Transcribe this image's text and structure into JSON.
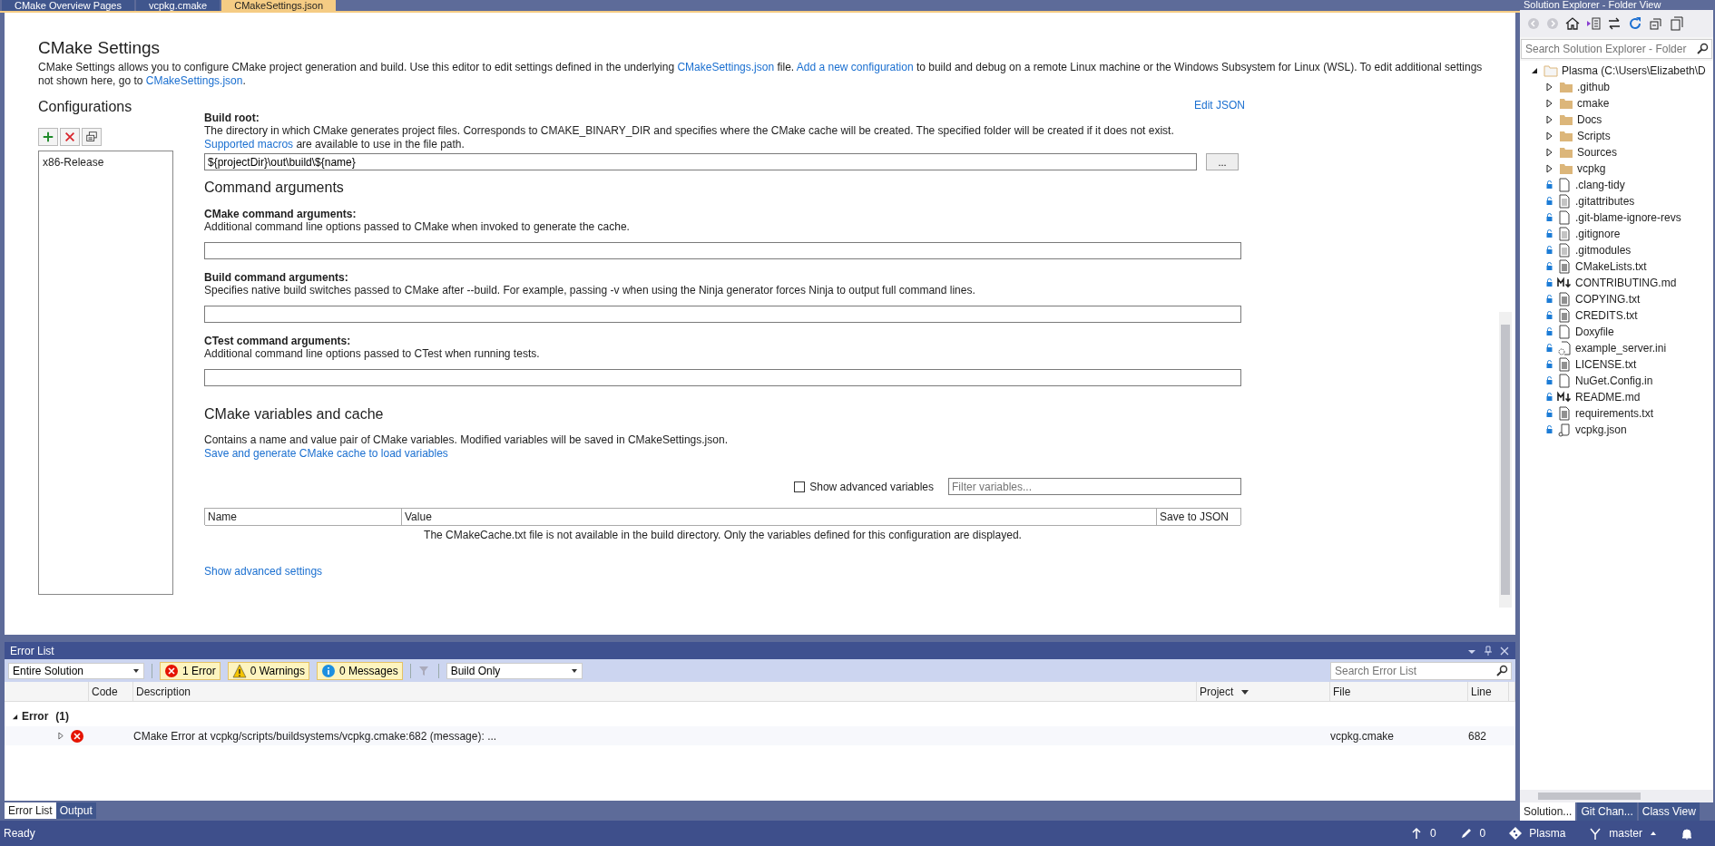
{
  "document_tabs": [
    {
      "label": "CMake Overview Pages",
      "selected": false
    },
    {
      "label": "vcpkg.cmake",
      "selected": false
    },
    {
      "label": "CMakeSettings.json",
      "selected": true
    }
  ],
  "settings": {
    "title": "CMake Settings",
    "intro": [
      {
        "kind": "text",
        "text": "CMake Settings allows you to configure CMake project generation and build. Use this editor to edit settings defined in the underlying "
      },
      {
        "kind": "link",
        "text": "CMakeSettings.json"
      },
      {
        "kind": "text",
        "text": " file. "
      },
      {
        "kind": "link",
        "text": "Add a new configuration"
      },
      {
        "kind": "text",
        "text": " to build and debug on a remote Linux machine or the Windows Subsystem for Linux (WSL). To edit additional settings not shown here, go to "
      },
      {
        "kind": "link",
        "text": "CMakeSettings.json"
      },
      {
        "kind": "text",
        "text": "."
      }
    ],
    "edit_json": "Edit JSON"
  },
  "configurations": {
    "heading": "Configurations",
    "items": [
      {
        "label": "x86-Release"
      }
    ]
  },
  "build_root": {
    "label": "Build root:",
    "description": [
      {
        "kind": "text",
        "text": "The directory in which CMake generates project files. Corresponds to CMAKE_BINARY_DIR and specifies where the CMake cache will be created. The specified folder will be created if it does not exist. "
      },
      {
        "kind": "link",
        "text": "Supported macros"
      },
      {
        "kind": "text",
        "text": " are available to use in the file path."
      }
    ],
    "value": "${projectDir}\\out\\build\\${name}",
    "browse": "..."
  },
  "command_arguments": {
    "heading": "Command arguments",
    "fields": [
      {
        "label": "CMake command arguments:",
        "description": "Additional command line options passed to CMake when invoked to generate the cache."
      },
      {
        "label": "Build command arguments:",
        "description": "Specifies native build switches passed to CMake after --build. For example, passing -v when using the Ninja generator forces Ninja to output full command lines."
      },
      {
        "label": "CTest command arguments:",
        "description": "Additional command line options passed to CTest when running tests."
      }
    ]
  },
  "variables": {
    "heading": "CMake variables and cache",
    "description": "Contains a name and value pair of CMake variables. Modified variables will be saved in CMakeSettings.json.",
    "link": "Save and generate CMake cache to load variables",
    "show_advanced": {
      "label": "Show advanced variables",
      "checked": false
    },
    "filter_placeholder": "Filter variables...",
    "columns": [
      "Name",
      "Value",
      "Save to JSON"
    ],
    "empty_message": "The CMakeCache.txt file is not available in the build directory. Only the variables defined for this configuration are displayed."
  },
  "show_advanced_settings": "Show advanced settings",
  "error_list": {
    "title": "Error List",
    "scope": "Entire Solution",
    "filters": [
      {
        "kind": "error",
        "label": "1 Error",
        "selected": true
      },
      {
        "kind": "warning",
        "label": "0 Warnings",
        "selected": true
      },
      {
        "kind": "message",
        "label": "0 Messages",
        "selected": true
      }
    ],
    "build_filter": "Build Only",
    "search_placeholder": "Search Error List",
    "columns": [
      "Code",
      "Description",
      "Project",
      "File",
      "Line"
    ],
    "groups": [
      {
        "label": "Error",
        "count": "(1)",
        "expanded": true,
        "rows": [
          {
            "expanded": false,
            "description": "CMake Error at vcpkg/scripts/buildsystems/vcpkg.cmake:682 (message): ...",
            "file": "vcpkg.cmake",
            "line": "682"
          }
        ]
      }
    ]
  },
  "bottom_tabs": [
    {
      "label": "Error List",
      "selected": true
    },
    {
      "label": "Output",
      "selected": false
    }
  ],
  "solution_explorer": {
    "title": "Solution Explorer - Folder View",
    "search_placeholder": "Search Solution Explorer - Folder",
    "tree": [
      {
        "label": "Plasma (C:\\Users\\Elizabeth\\D",
        "kind": "root",
        "expanded": true,
        "children": [
          {
            "label": ".github",
            "kind": "folder",
            "expanded": false
          },
          {
            "label": "cmake",
            "kind": "folder",
            "expanded": false
          },
          {
            "label": "Docs",
            "kind": "folder",
            "expanded": false
          },
          {
            "label": "Scripts",
            "kind": "folder",
            "expanded": false
          },
          {
            "label": "Sources",
            "kind": "folder",
            "expanded": false
          },
          {
            "label": "vcpkg",
            "kind": "folder",
            "expanded": false
          },
          {
            "label": ".clang-tidy",
            "kind": "file"
          },
          {
            "label": ".gitattributes",
            "kind": "text"
          },
          {
            "label": ".git-blame-ignore-revs",
            "kind": "file"
          },
          {
            "label": ".gitignore",
            "kind": "text"
          },
          {
            "label": ".gitmodules",
            "kind": "text"
          },
          {
            "label": "CMakeLists.txt",
            "kind": "doc"
          },
          {
            "label": "CONTRIBUTING.md",
            "kind": "markdown"
          },
          {
            "label": "COPYING.txt",
            "kind": "doc"
          },
          {
            "label": "CREDITS.txt",
            "kind": "doc"
          },
          {
            "label": "Doxyfile",
            "kind": "file"
          },
          {
            "label": "example_server.ini",
            "kind": "config"
          },
          {
            "label": "LICENSE.txt",
            "kind": "doc"
          },
          {
            "label": "NuGet.Config.in",
            "kind": "file"
          },
          {
            "label": "README.md",
            "kind": "markdown"
          },
          {
            "label": "requirements.txt",
            "kind": "doc"
          },
          {
            "label": "vcpkg.json",
            "kind": "json"
          }
        ]
      }
    ],
    "tabs": [
      {
        "label": "Solution...",
        "selected": true
      },
      {
        "label": "Git Chan...",
        "selected": false
      },
      {
        "label": "Class View",
        "selected": false
      }
    ]
  },
  "status_bar": {
    "text": "Ready",
    "items": [
      {
        "kind": "push",
        "label": "0"
      },
      {
        "kind": "edit",
        "label": "0"
      },
      {
        "kind": "repo",
        "label": "Plasma"
      },
      {
        "kind": "branch",
        "label": "master"
      }
    ]
  }
}
